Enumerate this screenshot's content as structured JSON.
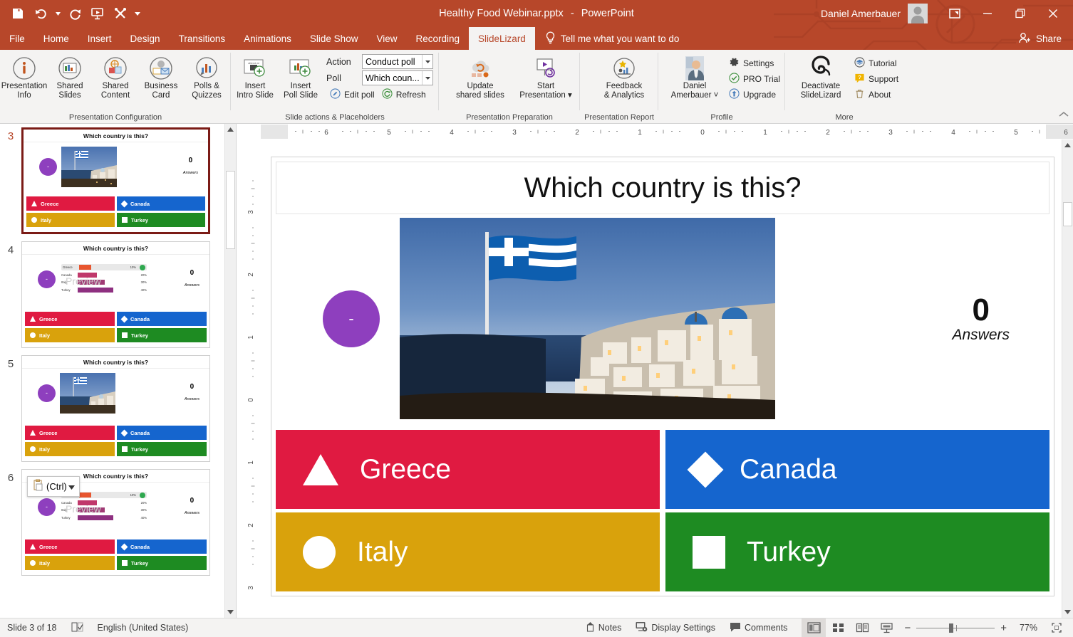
{
  "titlebar": {
    "quick_access": [
      {
        "name": "save-icon",
        "label": "Save"
      },
      {
        "name": "undo-icon",
        "label": "Undo"
      },
      {
        "name": "redo-icon",
        "label": "Redo"
      },
      {
        "name": "start-from-beginning-icon",
        "label": "Start From Beginning"
      },
      {
        "name": "customize-tools-icon",
        "label": "Customize Quick Access Toolbar"
      }
    ],
    "document_name": "Healthy Food Webinar.pptx",
    "separator": "-",
    "app_name": "PowerPoint",
    "user_name": "Daniel Amerbauer",
    "window_controls": {
      "ribbon_display_options": "Ribbon Display Options",
      "minimize": "Minimize",
      "restore": "Restore Down",
      "close": "Close"
    },
    "accent_color": "#b7472a"
  },
  "tabs": [
    {
      "label": "File",
      "active": false
    },
    {
      "label": "Home",
      "active": false
    },
    {
      "label": "Insert",
      "active": false
    },
    {
      "label": "Design",
      "active": false
    },
    {
      "label": "Transitions",
      "active": false
    },
    {
      "label": "Animations",
      "active": false
    },
    {
      "label": "Slide Show",
      "active": false
    },
    {
      "label": "View",
      "active": false
    },
    {
      "label": "Recording",
      "active": false
    },
    {
      "label": "SlideLizard",
      "active": true
    }
  ],
  "tell_me": "Tell me what you want to do",
  "share": "Share",
  "ribbon": {
    "groups": [
      {
        "title": "Presentation Configuration",
        "buttons": [
          {
            "label_1": "Presentation",
            "label_2": "Info",
            "icon": "info-circle-icon"
          },
          {
            "label_1": "Shared",
            "label_2": "Slides",
            "icon": "shared-slides-icon"
          },
          {
            "label_1": "Shared",
            "label_2": "Content",
            "icon": "shared-content-icon"
          },
          {
            "label_1": "Business",
            "label_2": "Card",
            "icon": "business-card-icon"
          },
          {
            "label_1": "Polls &",
            "label_2": "Quizzes",
            "icon": "polls-quizzes-icon"
          }
        ]
      },
      {
        "title": "Slide actions & Placeholders",
        "buttons": [
          {
            "label_1": "Insert",
            "label_2": "Intro Slide",
            "icon": "insert-intro-slide-icon"
          },
          {
            "label_1": "Insert",
            "label_2": "Poll Slide",
            "icon": "insert-poll-slide-icon"
          }
        ],
        "fields": [
          {
            "label": "Action",
            "value": "Conduct poll"
          },
          {
            "label": "Poll",
            "value": "Which coun..."
          }
        ],
        "small_buttons": [
          {
            "label": "Edit poll",
            "icon": "edit-pencil-icon"
          },
          {
            "label": "Refresh",
            "icon": "refresh-icon"
          }
        ]
      },
      {
        "title": "Presentation Preparation",
        "buttons": [
          {
            "label_1": "Update",
            "label_2": "shared slides",
            "icon": "update-shared-slides-icon"
          },
          {
            "label_1": "Start",
            "label_2": "Presentation",
            "icon": "start-presentation-icon",
            "dropdown": true
          }
        ]
      },
      {
        "title": "Presentation Report",
        "buttons": [
          {
            "label_1": "Feedback",
            "label_2": "& Analytics",
            "icon": "feedback-analytics-icon"
          }
        ]
      },
      {
        "title": "Profile",
        "buttons": [
          {
            "label_1": "Daniel",
            "label_2": "Amerbauer",
            "icon": "profile-photo-icon",
            "dropdown": true
          }
        ],
        "small_buttons": [
          {
            "label": "Settings",
            "icon": "gear-icon"
          },
          {
            "label": "PRO Trial",
            "icon": "check-circle-icon"
          },
          {
            "label": "Upgrade",
            "icon": "upgrade-arrow-icon"
          }
        ]
      },
      {
        "title": "More",
        "buttons": [
          {
            "label_1": "Deactivate",
            "label_2": "SlideLizard",
            "icon": "slidelizard-logo-icon"
          }
        ],
        "small_buttons": [
          {
            "label": "Tutorial",
            "icon": "tutorial-icon"
          },
          {
            "label": "Support",
            "icon": "support-icon"
          },
          {
            "label": "About",
            "icon": "about-trash-icon"
          }
        ]
      }
    ],
    "collapse_label": "Collapse the Ribbon"
  },
  "thumbnails": [
    {
      "number": "3",
      "selected": true,
      "kind": "image",
      "title": "Which country is this?",
      "dot": "-",
      "answers_count": "0",
      "answers_label": "Answers"
    },
    {
      "number": "4",
      "selected": false,
      "kind": "chart",
      "title": "Which country is this?",
      "dot": "-",
      "answers_count": "0",
      "answers_label": "Answers",
      "preview_watermark": "Preview",
      "paste_popup": "(Ctrl)"
    },
    {
      "number": "5",
      "selected": false,
      "kind": "image",
      "title": "Which country is this?",
      "dot": "-",
      "answers_count": "0",
      "answers_label": "Answers"
    },
    {
      "number": "6",
      "selected": false,
      "kind": "chart",
      "title": "Which country is this?",
      "dot": "-",
      "answers_count": "0",
      "answers_label": "Answers",
      "preview_watermark": "Preview"
    }
  ],
  "poll": {
    "question": "Which country is this?",
    "dot_label": "-",
    "answers_count": "0",
    "answers_label": "Answers",
    "options": [
      {
        "label": "Greece",
        "shape": "triangle",
        "color": "#e01a41"
      },
      {
        "label": "Canada",
        "shape": "diamond",
        "color": "#1565ce"
      },
      {
        "label": "Italy",
        "shape": "circle",
        "color": "#d9a20c"
      },
      {
        "label": "Turkey",
        "shape": "square",
        "color": "#1e8b22"
      }
    ],
    "results_preview": {
      "type": "bar",
      "orientation": "horizontal",
      "categories": [
        "Greece",
        "Canada",
        "Italy",
        "Turkey"
      ],
      "values": [
        10,
        20,
        30,
        40
      ],
      "value_labels": [
        "10%",
        "20%",
        "30%",
        "40%"
      ],
      "correct_answer": "Greece",
      "colors": [
        "#e8562f",
        "#c0386b",
        "#a03a75",
        "#8e3080"
      ],
      "xlabel": "",
      "ylabel": "",
      "xlim": [
        0,
        100
      ]
    }
  },
  "ruler": {
    "horizontal_ticks": [
      "6",
      "5",
      "4",
      "3",
      "2",
      "1",
      "0",
      "1",
      "2",
      "3",
      "4",
      "5",
      "6"
    ],
    "vertical_ticks": [
      "3",
      "2",
      "1",
      "0",
      "1",
      "2",
      "3"
    ]
  },
  "statusbar": {
    "slide_counter": "Slide 3 of 18",
    "spellcheck_icon": "spellcheck-icon",
    "language": "English (United States)",
    "notes": "Notes",
    "display_settings": "Display Settings",
    "comments": "Comments",
    "views": [
      {
        "name": "normal-view-icon",
        "label": "Normal",
        "active": true
      },
      {
        "name": "slide-sorter-icon",
        "label": "Slide Sorter",
        "active": false
      },
      {
        "name": "reading-view-icon",
        "label": "Reading View",
        "active": false
      },
      {
        "name": "slide-show-icon",
        "label": "Slide Show",
        "active": false
      }
    ],
    "zoom_out": "−",
    "zoom_in": "+",
    "zoom_level": "77%",
    "fit_to_window": "Fit slide to current window"
  }
}
